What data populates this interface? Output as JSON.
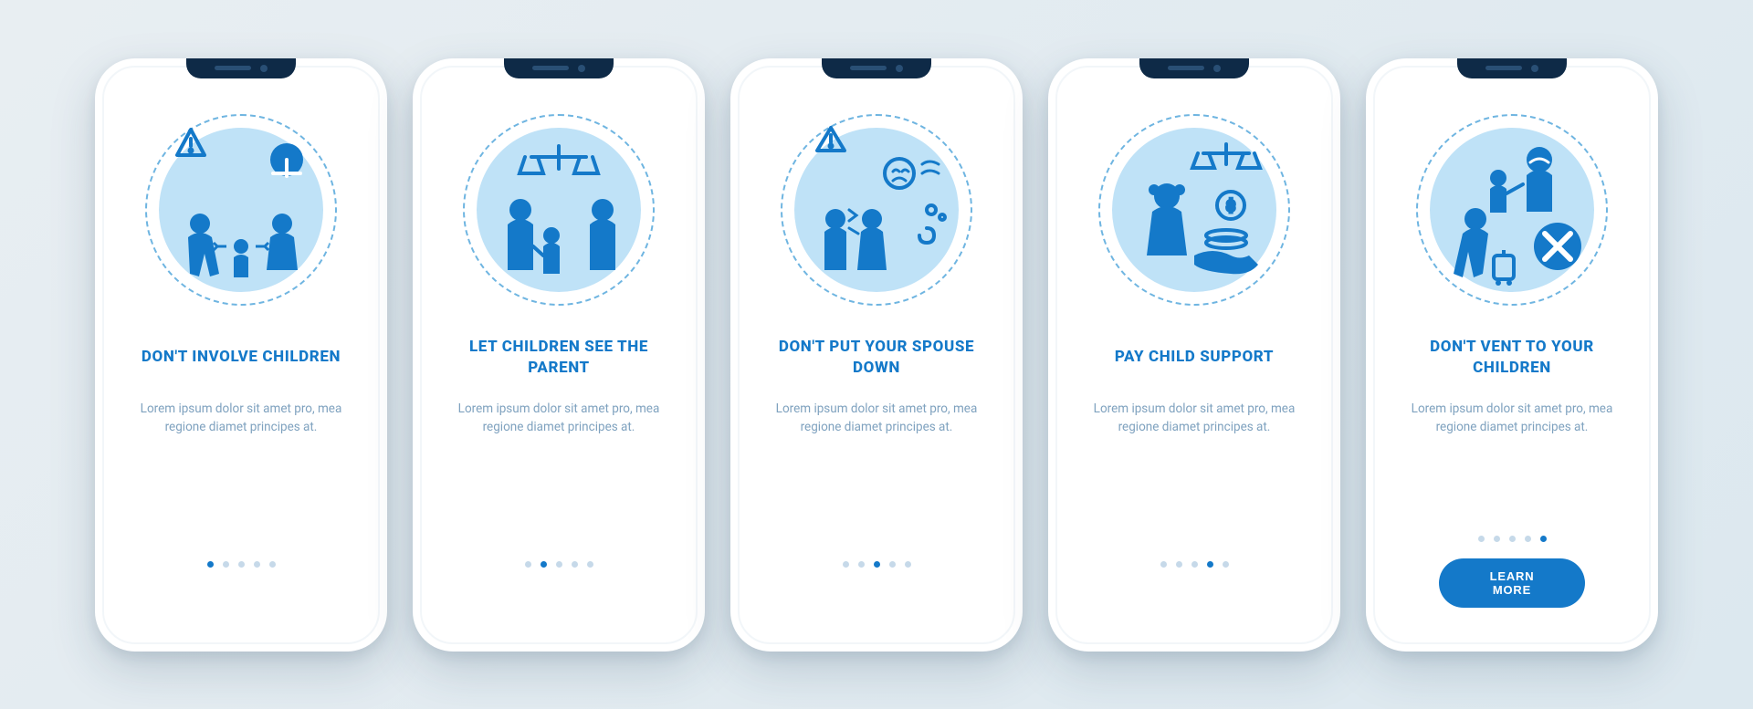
{
  "colors": {
    "primary": "#1479c9",
    "accent_light": "#bfe2f7",
    "text_muted": "#7fa2bf"
  },
  "total_screens": 5,
  "cta_label": "LEARN MORE",
  "lorem": "Lorem ipsum dolor sit amet pro, mea regione diamet principes at.",
  "screens": [
    {
      "title": "DON'T INVOLVE CHILDREN",
      "active_index": 0,
      "icon": "dont-involve-icon",
      "show_cta": false
    },
    {
      "title": "LET CHILDREN SEE THE PARENT",
      "active_index": 1,
      "icon": "see-parent-icon",
      "show_cta": false
    },
    {
      "title": "DON'T PUT YOUR SPOUSE DOWN",
      "active_index": 2,
      "icon": "spouse-down-icon",
      "show_cta": false
    },
    {
      "title": "PAY CHILD SUPPORT",
      "active_index": 3,
      "icon": "child-support-icon",
      "show_cta": false
    },
    {
      "title": "DON'T VENT TO YOUR CHILDREN",
      "active_index": 4,
      "icon": "dont-vent-icon",
      "show_cta": true
    }
  ]
}
